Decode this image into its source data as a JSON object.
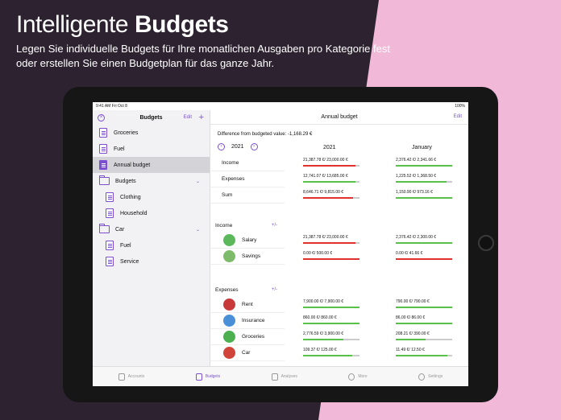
{
  "promo": {
    "headline_light": "Intelligente",
    "headline_bold": "Budgets",
    "subline": "Legen Sie individuelle Budgets für Ihre monatlichen Ausgaben pro Kategorie fest oder erstellen Sie einen Budgetplan für das ganze Jahr."
  },
  "status": {
    "time": "9:41 AM  Fri Oct 8",
    "battery": "100%"
  },
  "sidebar": {
    "title": "Budgets",
    "edit_label": "Edit",
    "items": [
      {
        "label": "Groceries",
        "type": "doc",
        "level": 0
      },
      {
        "label": "Fuel",
        "type": "doc",
        "level": 0
      },
      {
        "label": "Annual budget",
        "type": "doc",
        "level": 0,
        "selected": true
      },
      {
        "label": "Budgets",
        "type": "folder",
        "level": 0
      },
      {
        "label": "Clothing",
        "type": "doc",
        "level": 1
      },
      {
        "label": "Household",
        "type": "doc",
        "level": 1
      },
      {
        "label": "Car",
        "type": "folder",
        "level": 0
      },
      {
        "label": "Fuel",
        "type": "doc",
        "level": 1
      },
      {
        "label": "Service",
        "type": "doc",
        "level": 1
      }
    ]
  },
  "main": {
    "title": "Annual budget",
    "edit_label": "Edit",
    "difference": "Difference from budgeted value: -1,168.29 €",
    "year": "2021",
    "col_headers": [
      "2021",
      "January"
    ],
    "summary_rows": [
      {
        "label": "Income",
        "v1": "21,387.78 €/ 23,000.00 €",
        "v2": "2,376.42 €/ 2,341.66 €",
        "f1": 0.93,
        "c1": "#e03030",
        "f2": 1.0,
        "c2": "#56c24a"
      },
      {
        "label": "Expenses",
        "v1": "12,741.07 €/ 13,685.00 €",
        "v2": "1,225.52 €/ 1,368.50 €",
        "f1": 0.93,
        "c1": "#56c24a",
        "f2": 0.9,
        "c2": "#56c24a"
      },
      {
        "label": "Sum",
        "v1": "8,646.71 €/ 9,815.00 €",
        "v2": "1,150.90 €/ 973.16 €",
        "f1": 0.88,
        "c1": "#e03030",
        "f2": 1.0,
        "c2": "#56c24a"
      }
    ],
    "income_title": "Income",
    "income_plus": "+/-",
    "income_rows": [
      {
        "label": "Salary",
        "icon_color": "#5bb85b",
        "v1": "21,387.78 €/ 23,000.00 €",
        "v2": "2,376.42 €/ 2,300.00 €",
        "f1": 0.93,
        "c1": "#e03030",
        "f2": 1.0,
        "c2": "#56c24a"
      },
      {
        "label": "Savings",
        "icon_color": "#7dbb6a",
        "v1": "0.00 €/ 500.00 €",
        "v2": "0.00 €/ 41.66 €",
        "f1": 1.0,
        "c1": "#e03030",
        "f2": 1.0,
        "c2": "#e03030"
      }
    ],
    "expenses_title": "Expenses",
    "expenses_plus": "+/-",
    "expense_rows": [
      {
        "label": "Rent",
        "icon_color": "#c83a3a",
        "v1": "7,900.00 €/ 7,900.00 €",
        "v2": "790.00 €/ 790.00 €",
        "f1": 1.0,
        "c1": "#56c24a",
        "f2": 1.0,
        "c2": "#56c24a"
      },
      {
        "label": "Insurance",
        "icon_color": "#4a90d9",
        "v1": "860.00 €/ 860.00 €",
        "v2": "86.00 €/ 86.00 €",
        "f1": 1.0,
        "c1": "#56c24a",
        "f2": 1.0,
        "c2": "#56c24a"
      },
      {
        "label": "Groceries",
        "icon_color": "#4caf50",
        "v1": "2,776.59 €/ 3,900.00 €",
        "v2": "208.21 €/ 390.00 €",
        "f1": 0.71,
        "c1": "#56c24a",
        "f2": 0.53,
        "c2": "#56c24a"
      },
      {
        "label": "Car",
        "icon_color": "#d0443a",
        "v1": "109.37 €/ 125.00 €",
        "v2": "11.49 €/ 12.50 €",
        "f1": 0.87,
        "c1": "#56c24a",
        "f2": 0.92,
        "c2": "#56c24a"
      }
    ]
  },
  "tabs": [
    {
      "label": "Accounts",
      "active": false
    },
    {
      "label": "Budgets",
      "active": true
    },
    {
      "label": "Analyses",
      "active": false
    },
    {
      "label": "More",
      "active": false
    },
    {
      "label": "Settings",
      "active": false
    }
  ],
  "colors": {
    "accent": "#7b4fd0",
    "over": "#e03030",
    "ok": "#56c24a"
  }
}
